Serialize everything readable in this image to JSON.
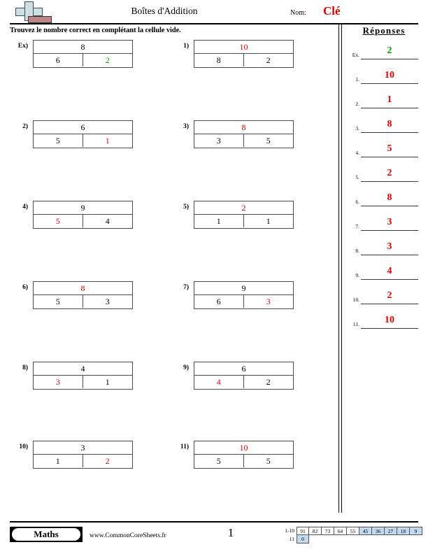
{
  "header": {
    "title": "Boîtes d'Addition",
    "name_label": "Nom:",
    "name_value": "Clé",
    "logo_icon": "plus-logo-icon"
  },
  "instruction": "Trouvez le nombre correct en complétant la cellule vide.",
  "colors": {
    "answer_red": "#e60000",
    "example_green": "#00a000",
    "scale_highlight": "#c2d9f0"
  },
  "problems": [
    {
      "num": "Ex)",
      "top": "8",
      "left": "6",
      "right": "2",
      "answer_pos": "right",
      "answer_color": "green"
    },
    {
      "num": "1)",
      "top": "10",
      "left": "8",
      "right": "2",
      "answer_pos": "top",
      "answer_color": "red"
    },
    {
      "num": "2)",
      "top": "6",
      "left": "5",
      "right": "1",
      "answer_pos": "right",
      "answer_color": "red"
    },
    {
      "num": "3)",
      "top": "8",
      "left": "3",
      "right": "5",
      "answer_pos": "top",
      "answer_color": "red"
    },
    {
      "num": "4)",
      "top": "9",
      "left": "5",
      "right": "4",
      "answer_pos": "left",
      "answer_color": "red"
    },
    {
      "num": "5)",
      "top": "2",
      "left": "1",
      "right": "1",
      "answer_pos": "top",
      "answer_color": "red"
    },
    {
      "num": "6)",
      "top": "8",
      "left": "5",
      "right": "3",
      "answer_pos": "top",
      "answer_color": "red"
    },
    {
      "num": "7)",
      "top": "9",
      "left": "6",
      "right": "3",
      "answer_pos": "right",
      "answer_color": "red"
    },
    {
      "num": "8)",
      "top": "4",
      "left": "3",
      "right": "1",
      "answer_pos": "left",
      "answer_color": "red"
    },
    {
      "num": "9)",
      "top": "6",
      "left": "4",
      "right": "2",
      "answer_pos": "left",
      "answer_color": "red"
    },
    {
      "num": "10)",
      "top": "3",
      "left": "1",
      "right": "2",
      "answer_pos": "right",
      "answer_color": "red"
    },
    {
      "num": "11)",
      "top": "10",
      "left": "5",
      "right": "5",
      "answer_pos": "top",
      "answer_color": "red"
    }
  ],
  "answers_panel": {
    "title": "Réponses",
    "rows": [
      {
        "label": "Ex.",
        "value": "2",
        "color": "green"
      },
      {
        "label": "1.",
        "value": "10",
        "color": "red"
      },
      {
        "label": "2.",
        "value": "1",
        "color": "red"
      },
      {
        "label": "3.",
        "value": "8",
        "color": "red"
      },
      {
        "label": "4.",
        "value": "5",
        "color": "red"
      },
      {
        "label": "5.",
        "value": "2",
        "color": "red"
      },
      {
        "label": "6.",
        "value": "8",
        "color": "red"
      },
      {
        "label": "7.",
        "value": "3",
        "color": "red"
      },
      {
        "label": "8.",
        "value": "3",
        "color": "red"
      },
      {
        "label": "9.",
        "value": "4",
        "color": "red"
      },
      {
        "label": "10.",
        "value": "2",
        "color": "red"
      },
      {
        "label": "11.",
        "value": "10",
        "color": "red"
      }
    ]
  },
  "footer": {
    "badge": "Maths",
    "website": "www.CommonCoreSheets.fr",
    "page_number": "1",
    "scale": {
      "row1_label": "1-10",
      "row1": [
        {
          "v": "91",
          "hl": false
        },
        {
          "v": "82",
          "hl": false
        },
        {
          "v": "73",
          "hl": false
        },
        {
          "v": "64",
          "hl": false
        },
        {
          "v": "55",
          "hl": false
        },
        {
          "v": "45",
          "hl": true
        },
        {
          "v": "36",
          "hl": true
        },
        {
          "v": "27",
          "hl": true
        },
        {
          "v": "18",
          "hl": true
        },
        {
          "v": "9",
          "hl": true
        }
      ],
      "row2_label": "11",
      "row2": [
        {
          "v": "0",
          "hl": true
        }
      ]
    }
  }
}
